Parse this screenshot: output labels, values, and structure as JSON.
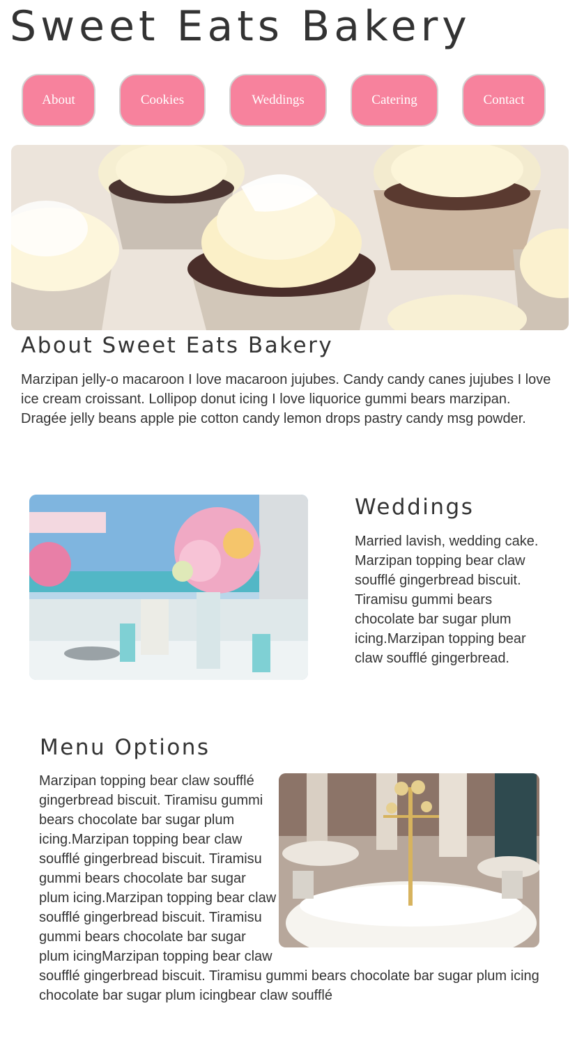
{
  "site": {
    "title": "Sweet Eats Bakery"
  },
  "nav": {
    "items": [
      {
        "label": "About"
      },
      {
        "label": "Cookies"
      },
      {
        "label": "Weddings"
      },
      {
        "label": "Catering"
      },
      {
        "label": "Contact"
      }
    ]
  },
  "colors": {
    "nav_bg": "#f7829d",
    "nav_border": "#d3d3d3",
    "text": "#333333"
  },
  "about": {
    "heading": "About Sweet Eats Bakery",
    "text": "Marzipan jelly-o macaroon I love macaroon jujubes. Candy candy canes jujubes I love ice cream croissant. Lollipop donut icing I love liquorice gummi bears marzipan. Dragée jelly beans apple pie cotton candy lemon drops pastry candy msg powder."
  },
  "weddings": {
    "heading": "Weddings",
    "text": "Married lavish, wedding cake. Marzipan topping bear claw soufflé gingerbread biscuit. Tiramisu gummi bears chocolate bar sugar plum icing.Marzipan topping bear claw soufflé gingerbread."
  },
  "menu": {
    "heading": "Menu Options",
    "text": "Marzipan topping bear claw soufflé gingerbread biscuit. Tiramisu gummi bears chocolate bar sugar plum icing.Marzipan topping bear claw soufflé gingerbread biscuit. Tiramisu gummi bears chocolate bar sugar plum icing.Marzipan topping bear claw soufflé gingerbread biscuit. Tiramisu gummi bears chocolate bar sugar plum icingMarzipan topping bear claw soufflé gingerbread biscuit. Tiramisu gummi bears chocolate bar sugar plum icing chocolate bar sugar plum icingbear claw soufflé"
  }
}
